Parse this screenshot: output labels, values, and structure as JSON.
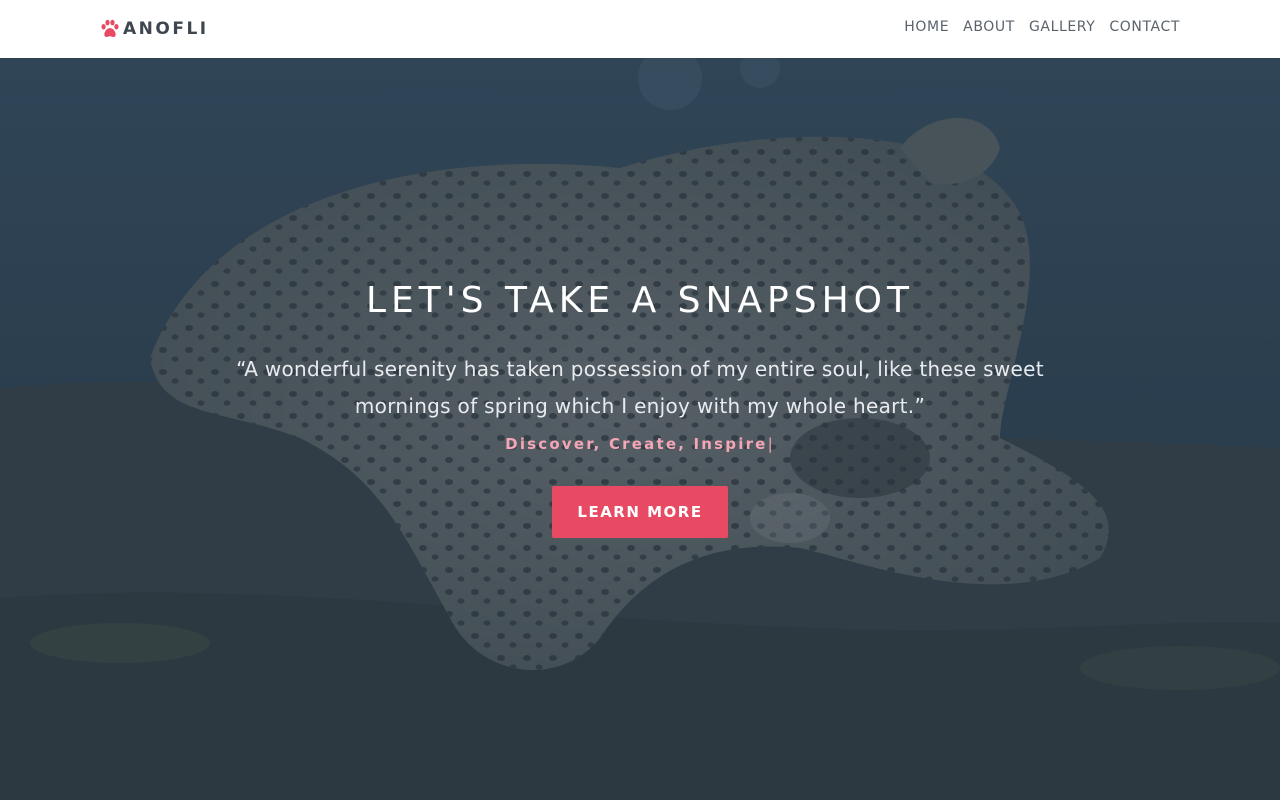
{
  "header": {
    "logo_icon": "paw-icon",
    "logo_text": "ANOFLI",
    "nav": [
      "HOME",
      "ABOUT",
      "GALLERY",
      "CONTACT"
    ]
  },
  "hero": {
    "background": "leopard-photo",
    "title": "LET'S TAKE A SNAPSHOT",
    "quote": "“A wonderful serenity has taken possession of my entire soul, like these sweet mornings of spring which I enjoy with my whole heart.”",
    "typed_text": "Discover, Create, Inspire",
    "cursor": "|",
    "button_label": "LEARN MORE"
  },
  "colors": {
    "accent": "#e84a64",
    "typed_text": "#f4a6b6",
    "overlay": "#28384a",
    "nav_text": "#5a636b",
    "logo_text": "#3e4750"
  }
}
